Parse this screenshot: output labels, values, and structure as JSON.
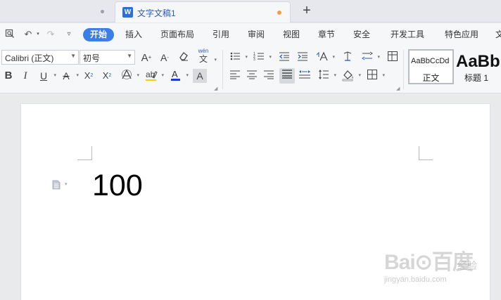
{
  "tabs": {
    "active_title": "文字文稿1",
    "app_icon_letter": "W",
    "new_tab_label": "+"
  },
  "quick_access": {
    "print_preview_icon": "print-preview-icon",
    "undo_icon": "undo-icon",
    "redo_icon": "redo-icon",
    "customize_icon": "customize-icon"
  },
  "menu": {
    "items": [
      "开始",
      "插入",
      "页面布局",
      "引用",
      "审阅",
      "视图",
      "章节",
      "安全",
      "开发工具",
      "特色应用",
      "文"
    ],
    "active_index": 0
  },
  "ribbon": {
    "font_name": "Calibri (正文)",
    "font_size": "初号",
    "pinyin_label": "wén",
    "pinyin_char": "文",
    "styles": [
      {
        "sample": "AaBbCcDd",
        "label": "正文"
      },
      {
        "sample": "AaBb",
        "label": "标题 1"
      }
    ]
  },
  "document": {
    "body_text": "100"
  },
  "watermark": {
    "logo": "Bai⊙百度",
    "suffix": "经验",
    "url": "jingyan.baidu.com"
  },
  "colors": {
    "accent": "#3d7de6",
    "font_color_underline": "#1a3fd0",
    "highlight_underline": "#f5d000",
    "modified_dot": "#f0a040"
  }
}
